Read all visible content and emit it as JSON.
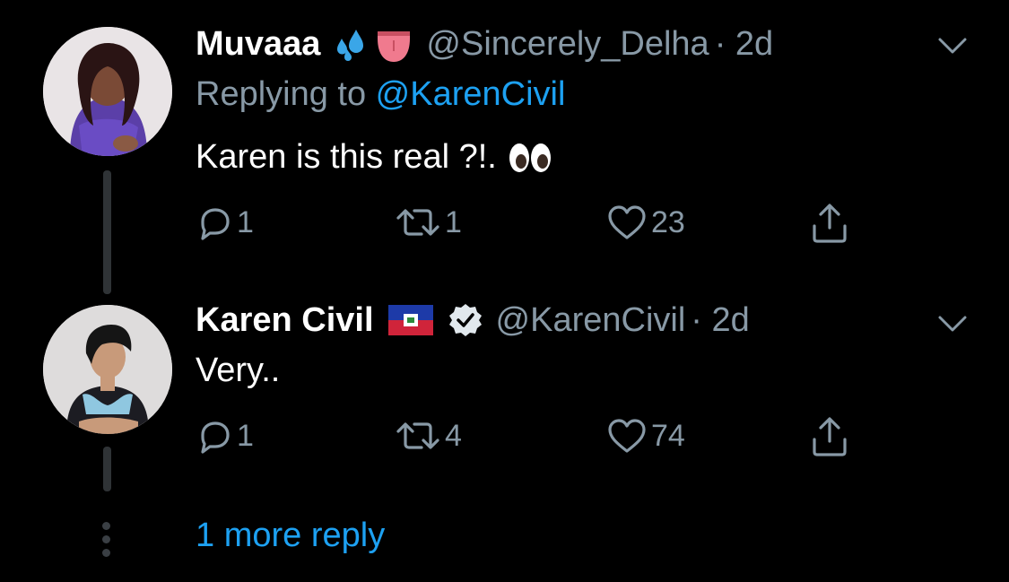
{
  "tweets": [
    {
      "display_name": "Muvaaa",
      "display_name_emojis": [
        "sweat-droplets-emoji",
        "tongue-emoji"
      ],
      "handle": "@Sincerely_Delha",
      "time": "· 2d",
      "replying_prefix": "Replying to ",
      "replying_handle": "@KarenCivil",
      "text": "Karen is this real ?!.",
      "text_emoji": "eyes-emoji",
      "replies": "1",
      "retweets": "1",
      "likes": "23"
    },
    {
      "display_name": "Karen Civil",
      "display_name_emojis": [
        "haiti-flag-emoji",
        "verified-badge"
      ],
      "handle": "@KarenCivil",
      "time": "· 2d",
      "text": "Very..",
      "replies": "1",
      "retweets": "4",
      "likes": "74"
    }
  ],
  "more_replies_label": "1 more reply",
  "colors": {
    "background": "#000000",
    "secondary_text": "#8899a6",
    "link": "#1da1f2",
    "thread_line": "#2f3336"
  }
}
